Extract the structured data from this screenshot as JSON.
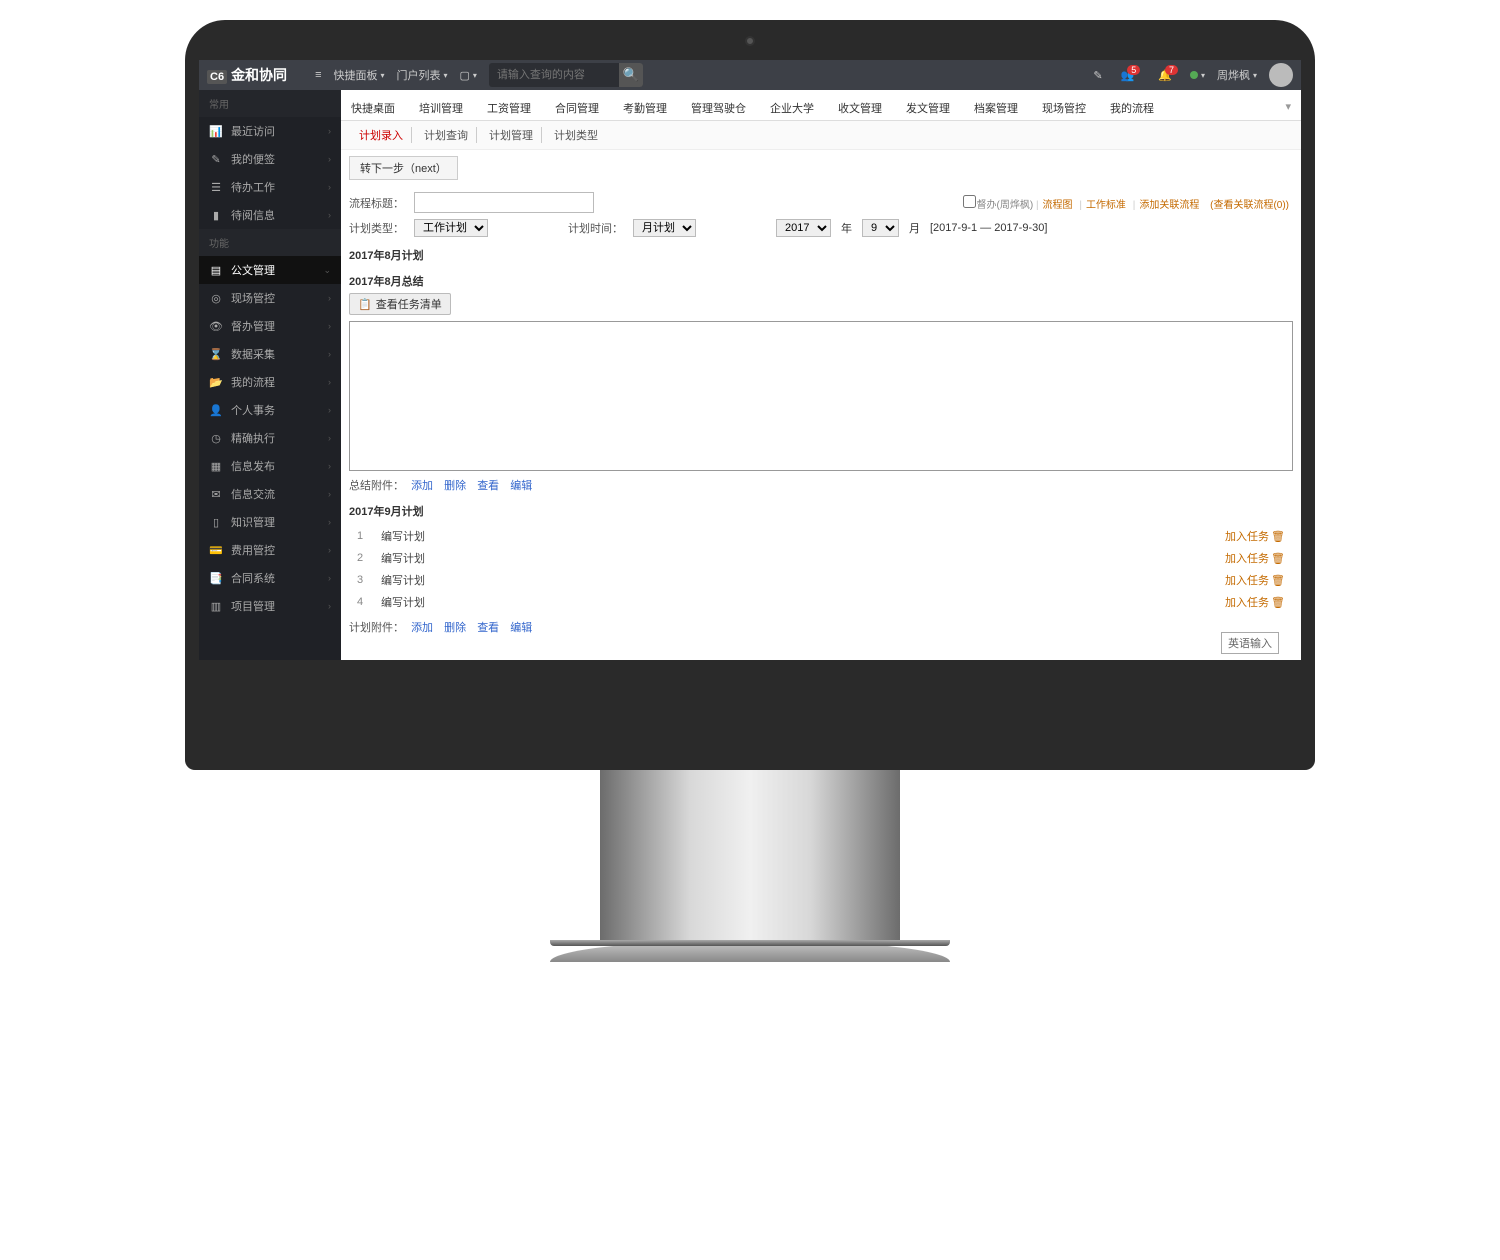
{
  "appTitle": "金和协同",
  "appTag": "C6",
  "topbar": {
    "collapseIcon": "≡",
    "quickPanel": "快捷面板",
    "portalList": "门户列表",
    "deviceIcon": "▢",
    "searchPlaceholder": "请输入查询的内容",
    "wandIcon": "✎",
    "usersBadge": "5",
    "bellBadge": "7",
    "userName": "周烨枫"
  },
  "sidebar": {
    "common": "常用",
    "commonItems": [
      {
        "icon": "📊",
        "label": "最近访问"
      },
      {
        "icon": "✎",
        "label": "我的便签"
      },
      {
        "icon": "☰",
        "label": "待办工作"
      },
      {
        "icon": "▮",
        "label": "待阅信息"
      }
    ],
    "func": "功能",
    "funcItems": [
      {
        "icon": "▤",
        "label": "公文管理",
        "active": true,
        "chev": "⌄"
      },
      {
        "icon": "◎",
        "label": "现场管控"
      },
      {
        "icon": "👁",
        "label": "督办管理"
      },
      {
        "icon": "⌛",
        "label": "数据采集"
      },
      {
        "icon": "📂",
        "label": "我的流程"
      },
      {
        "icon": "👤",
        "label": "个人事务"
      },
      {
        "icon": "◷",
        "label": "精确执行"
      },
      {
        "icon": "▦",
        "label": "信息发布"
      },
      {
        "icon": "✉",
        "label": "信息交流"
      },
      {
        "icon": "▯",
        "label": "知识管理"
      },
      {
        "icon": "💳",
        "label": "费用管控"
      },
      {
        "icon": "📑",
        "label": "合同系统"
      },
      {
        "icon": "▥",
        "label": "项目管理"
      }
    ]
  },
  "tabs": [
    "快捷桌面",
    "培训管理",
    "工资管理",
    "合同管理",
    "考勤管理",
    "管理驾驶仓",
    "企业大学",
    "收文管理",
    "发文管理",
    "档案管理",
    "现场管控",
    "我的流程"
  ],
  "subtabs": [
    "计划录入",
    "计划查询",
    "计划管理",
    "计划类型"
  ],
  "activeSubtab": 0,
  "nextBtn": "转下一步（next）",
  "form": {
    "titleLabel": "流程标题：",
    "typeLabel": "计划类型：",
    "typeValue": "工作计划",
    "timeLabel": "计划时间：",
    "timeValue": "月计划",
    "yearValue": "2017",
    "yearUnit": "年",
    "monthValue": "9",
    "monthUnit": "月",
    "dateRange": "[2017-9-1 — 2017-9-30]",
    "supervise": "督办(周烨枫)",
    "links": [
      "流程图",
      "工作标准",
      "添加关联流程"
    ],
    "viewRelated": "(查看关联流程(0))"
  },
  "sections": {
    "aug_plan": "2017年8月计划",
    "aug_summary": "2017年8月总结",
    "sep_plan": "2017年9月计划"
  },
  "viewTaskList": "查看任务清单",
  "attach": {
    "summaryLabel": "总结附件：",
    "planLabel": "计划附件：",
    "actions": [
      "添加",
      "删除",
      "查看",
      "编辑"
    ]
  },
  "tasks": [
    {
      "n": "1",
      "name": "编写计划"
    },
    {
      "n": "2",
      "name": "编写计划"
    },
    {
      "n": "3",
      "name": "编写计划"
    },
    {
      "n": "4",
      "name": "编写计划"
    }
  ],
  "addTask": "加入任务",
  "ime": "英语输入"
}
